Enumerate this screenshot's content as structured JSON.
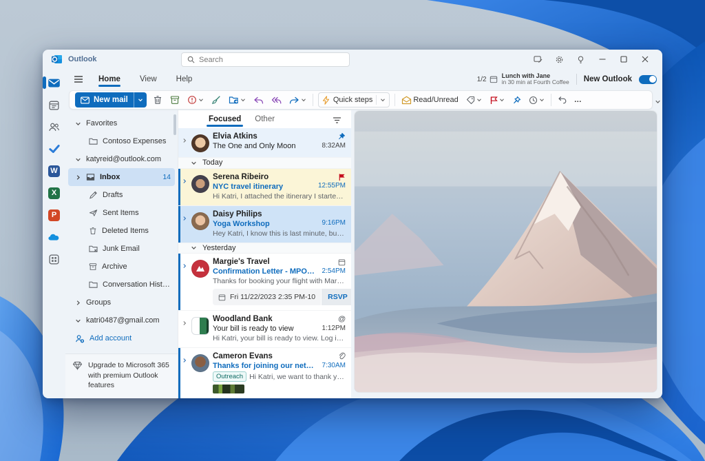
{
  "titlebar": {
    "app_name": "Outlook",
    "search_placeholder": "Search"
  },
  "ribbon": {
    "tabs": [
      {
        "label": "Home"
      },
      {
        "label": "View"
      },
      {
        "label": "Help"
      }
    ],
    "pager": "1/2",
    "reminder": {
      "title": "Lunch with Jane",
      "subtitle": "in 30 min at Fourth Coffee"
    },
    "new_outlook_label": "New Outlook"
  },
  "toolbar": {
    "new_mail": "New mail",
    "quick_steps": "Quick steps",
    "read_unread": "Read/Unread",
    "more": "…"
  },
  "icons": {
    "mention": "@",
    "word": "W",
    "excel": "X",
    "ppt": "P"
  },
  "folders": {
    "items": [
      {
        "label": "Favorites"
      },
      {
        "label": "Contoso Expenses"
      },
      {
        "label": "katyreid@outlook.com"
      },
      {
        "label": "Inbox",
        "count": "14"
      },
      {
        "label": "Drafts"
      },
      {
        "label": "Sent Items"
      },
      {
        "label": "Deleted Items"
      },
      {
        "label": "Junk Email"
      },
      {
        "label": "Archive"
      },
      {
        "label": "Conversation History"
      },
      {
        "label": "Groups"
      },
      {
        "label": "katri0487@gmail.com"
      },
      {
        "label": "Add account"
      }
    ],
    "upgrade_text": "Upgrade to Microsoft 365 with premium Outlook features"
  },
  "maillist": {
    "tabs": [
      {
        "label": "Focused"
      },
      {
        "label": "Other"
      }
    ],
    "groups": {
      "today": "Today",
      "yesterday": "Yesterday"
    },
    "messages": [
      {
        "sender": "Elvia Atkins",
        "subject": "The One and Only Moon",
        "time": "8:32AM"
      },
      {
        "sender": "Serena Ribeiro",
        "subject": "NYC travel itinerary",
        "time": "12:55PM",
        "preview": "Hi Katri, I attached the itinerary I started fo..."
      },
      {
        "sender": "Daisy Philips",
        "subject": "Yoga Workshop",
        "time": "9:16PM",
        "preview": "Hey Katri, I know this is last minute, but do..."
      },
      {
        "sender": "Margie's Travel",
        "subject": "Confirmation Letter - MPOWMQ",
        "time": "2:54PM",
        "preview": "Thanks for booking your flight with Margi...",
        "event_when": "Fri 11/22/2023 2:35 PM-10",
        "rsvp": "RSVP"
      },
      {
        "sender": "Woodland Bank",
        "subject": "Your bill is ready to view",
        "time": "1:12PM",
        "preview": "Hi Katri, your bill is ready to view. Log in to..."
      },
      {
        "sender": "Cameron Evans",
        "subject": "Thanks for joining our networking...",
        "time": "7:30AM",
        "preview": "Hi Katri, we want to thank you f...",
        "tag": "Outreach"
      }
    ]
  },
  "colors": {
    "accent": "#0f6cbd",
    "flag_red": "#c50f1f",
    "selected_row": "#cfe3f7",
    "flagged_row": "#fbf5d7",
    "pinned_row": "#e9f2fb",
    "bloom_blue": "#1b66cc"
  }
}
